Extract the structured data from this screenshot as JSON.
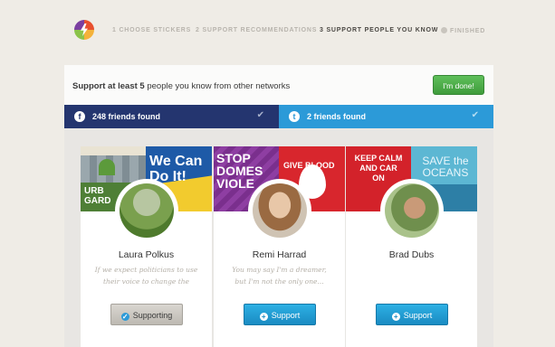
{
  "header": {
    "steps": [
      {
        "label": "1 CHOOSE STICKERS",
        "active": false
      },
      {
        "label": "2 SUPPORT RECOMMENDATIONS",
        "active": false
      },
      {
        "label": "3 SUPPORT PEOPLE YOU KNOW",
        "active": true
      },
      {
        "label": "FINISHED",
        "active": false
      }
    ]
  },
  "panel": {
    "prompt_bold": "Support at least 5",
    "prompt_rest": " people you know from other networks",
    "done_label": "I'm done!"
  },
  "networks": {
    "facebook": {
      "icon": "f",
      "label": "248 friends found"
    },
    "twitter": {
      "icon": "t",
      "label": "2 friends found"
    }
  },
  "cards": [
    {
      "name": "Laura Polkus",
      "quote": "If we expect politicians to use their voice to change the",
      "button_label": "Supporting",
      "button_state": "supporting",
      "sticker_left_text": "URB GARD",
      "sticker_right_text": "We Can Do It!"
    },
    {
      "name": "Remi Harrad",
      "quote": "You may say I'm a dreamer, but I'm not the only one...",
      "button_label": "Support",
      "button_state": "support",
      "sticker_left_text": "STOP DOMES VIOLE",
      "sticker_right_text": "GIVE BLOOD LIFE"
    },
    {
      "name": "Brad Dubs",
      "quote": "",
      "button_label": "Support",
      "button_state": "support",
      "sticker_left_text": "KEEP CALM AND CAR ON",
      "sticker_right_text": "SAVE the OCEANS"
    }
  ],
  "colors": {
    "facebook": "#24356f",
    "twitter": "#2c9ad8",
    "done_green": "#4caf50",
    "support_blue": "#1a8bc2"
  }
}
